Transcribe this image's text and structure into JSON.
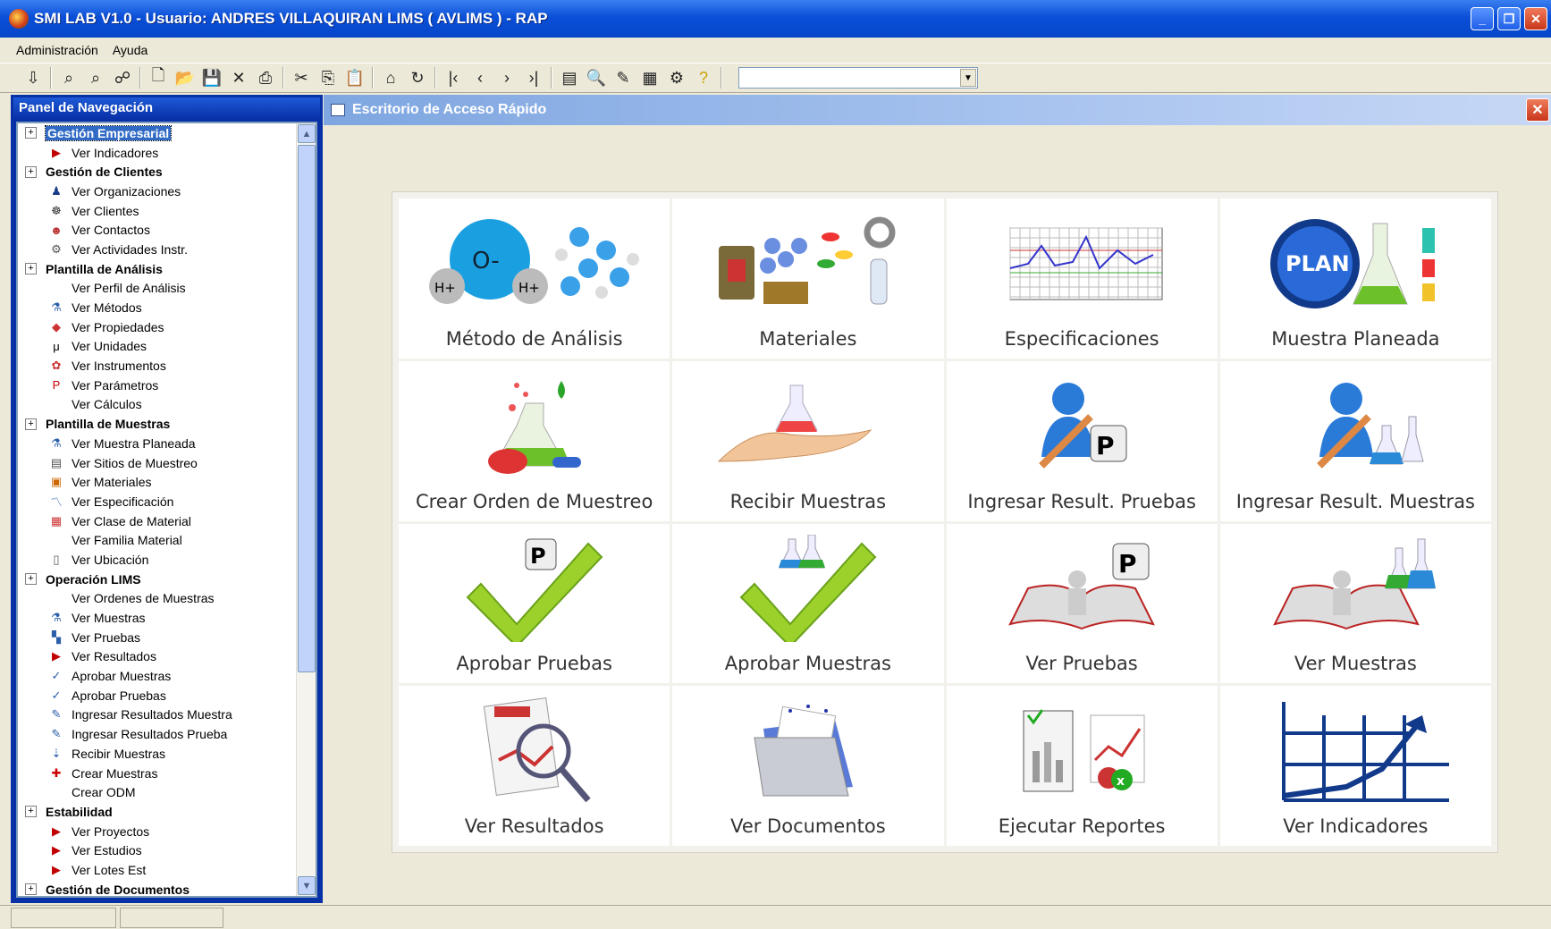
{
  "window": {
    "title": "SMI LAB  V1.0 - Usuario: ANDRES VILLAQUIRAN LIMS ( AVLIMS ) - RAP",
    "controls": [
      "minimize",
      "restore",
      "close"
    ]
  },
  "menu": [
    "Administración",
    "Ayuda"
  ],
  "toolbar": {
    "icons": [
      "exit-icon",
      "find-icon",
      "find-next-icon",
      "report-icon",
      "new-icon",
      "open-icon",
      "save-icon",
      "delete-icon",
      "print-icon",
      "cut-icon",
      "copy-icon",
      "paste-icon",
      "home-icon",
      "refresh-icon",
      "first-icon",
      "prev-icon",
      "next-icon",
      "last-icon",
      "doc-icon",
      "preview-icon",
      "edit-icon",
      "calendar-icon",
      "tools-icon",
      "help-icon"
    ],
    "combo_value": ""
  },
  "nav": {
    "title": "Panel de Navegación",
    "groups": [
      {
        "label": "Gestión Empresarial",
        "selected": true,
        "items": [
          {
            "label": "Ver Indicadores",
            "icon": "arrow-icon"
          }
        ]
      },
      {
        "label": "Gestión de Clientes",
        "items": [
          {
            "label": "Ver Organizaciones",
            "icon": "organization-icon"
          },
          {
            "label": "Ver Clientes",
            "icon": "clients-icon"
          },
          {
            "label": "Ver Contactos",
            "icon": "contacts-icon"
          },
          {
            "label": "Ver Actividades Instr.",
            "icon": "activities-icon"
          }
        ]
      },
      {
        "label": "Plantilla de Análisis",
        "items": [
          {
            "label": "Ver Perfil de Análisis",
            "icon": ""
          },
          {
            "label": "Ver Métodos",
            "icon": "methods-icon"
          },
          {
            "label": "Ver Propiedades",
            "icon": "properties-icon"
          },
          {
            "label": "Ver Unidades",
            "icon": "units-icon"
          },
          {
            "label": "Ver Instrumentos",
            "icon": "instruments-icon"
          },
          {
            "label": "Ver Parámetros",
            "icon": "parameters-icon"
          },
          {
            "label": "Ver Cálculos",
            "icon": ""
          }
        ]
      },
      {
        "label": "Plantilla de Muestras",
        "items": [
          {
            "label": "Ver Muestra Planeada",
            "icon": "planned-sample-icon"
          },
          {
            "label": "Ver Sitios de Muestreo",
            "icon": "sites-icon"
          },
          {
            "label": "Ver Materiales",
            "icon": "materials-icon"
          },
          {
            "label": "Ver Especificación",
            "icon": "specification-icon"
          },
          {
            "label": "Ver Clase de Material",
            "icon": "material-class-icon"
          },
          {
            "label": "Ver Familia Material",
            "icon": ""
          },
          {
            "label": "Ver Ubicación",
            "icon": "location-icon"
          }
        ]
      },
      {
        "label": "Operación LIMS",
        "items": [
          {
            "label": "Ver Ordenes de Muestras",
            "icon": ""
          },
          {
            "label": "Ver Muestras",
            "icon": "samples-icon"
          },
          {
            "label": "Ver Pruebas",
            "icon": "tests-icon"
          },
          {
            "label": "Ver Resultados",
            "icon": "arrow-icon"
          },
          {
            "label": "Aprobar Muestras",
            "icon": "approve-icon"
          },
          {
            "label": "Aprobar Pruebas",
            "icon": "approve-icon"
          },
          {
            "label": "Ingresar Resultados Muestra",
            "icon": "enter-results-icon"
          },
          {
            "label": "Ingresar Resultados Prueba",
            "icon": "enter-results-icon"
          },
          {
            "label": "Recibir Muestras",
            "icon": "receive-icon"
          },
          {
            "label": "Crear Muestras",
            "icon": "create-icon"
          },
          {
            "label": "Crear ODM",
            "icon": ""
          }
        ]
      },
      {
        "label": "Estabilidad",
        "items": [
          {
            "label": "Ver Proyectos",
            "icon": "arrow-icon"
          },
          {
            "label": "Ver Estudios",
            "icon": "arrow-icon"
          },
          {
            "label": "Ver Lotes Est",
            "icon": "arrow-icon"
          }
        ]
      },
      {
        "label": "Gestión de Documentos",
        "items": []
      }
    ]
  },
  "desktop": {
    "title": "Escritorio de Acceso Rápido",
    "tiles": [
      {
        "label": "Método de Análisis",
        "icon": "molecule-icon"
      },
      {
        "label": "Materiales",
        "icon": "materials-icon"
      },
      {
        "label": "Especificaciones",
        "icon": "chart-spec-icon"
      },
      {
        "label": "Muestra Planeada",
        "icon": "plan-flask-icon"
      },
      {
        "label": "Crear Orden de Muestreo",
        "icon": "flask-pills-icon"
      },
      {
        "label": "Recibir Muestras",
        "icon": "hand-flask-icon"
      },
      {
        "label": "Ingresar Result. Pruebas",
        "icon": "user-pencil-p-icon"
      },
      {
        "label": "Ingresar Result. Muestras",
        "icon": "user-pencil-flask-icon"
      },
      {
        "label": "Aprobar Pruebas",
        "icon": "check-p-icon"
      },
      {
        "label": "Aprobar Muestras",
        "icon": "check-flask-icon"
      },
      {
        "label": "Ver Pruebas",
        "icon": "book-p-icon"
      },
      {
        "label": "Ver Muestras",
        "icon": "book-flask-icon"
      },
      {
        "label": "Ver Resultados",
        "icon": "results-magnifier-icon"
      },
      {
        "label": "Ver Documentos",
        "icon": "folder-docs-icon"
      },
      {
        "label": "Ejecutar Reportes",
        "icon": "reports-icon"
      },
      {
        "label": "Ver Indicadores",
        "icon": "indicators-chart-icon"
      }
    ]
  },
  "status": {
    "panels": [
      "",
      ""
    ]
  }
}
